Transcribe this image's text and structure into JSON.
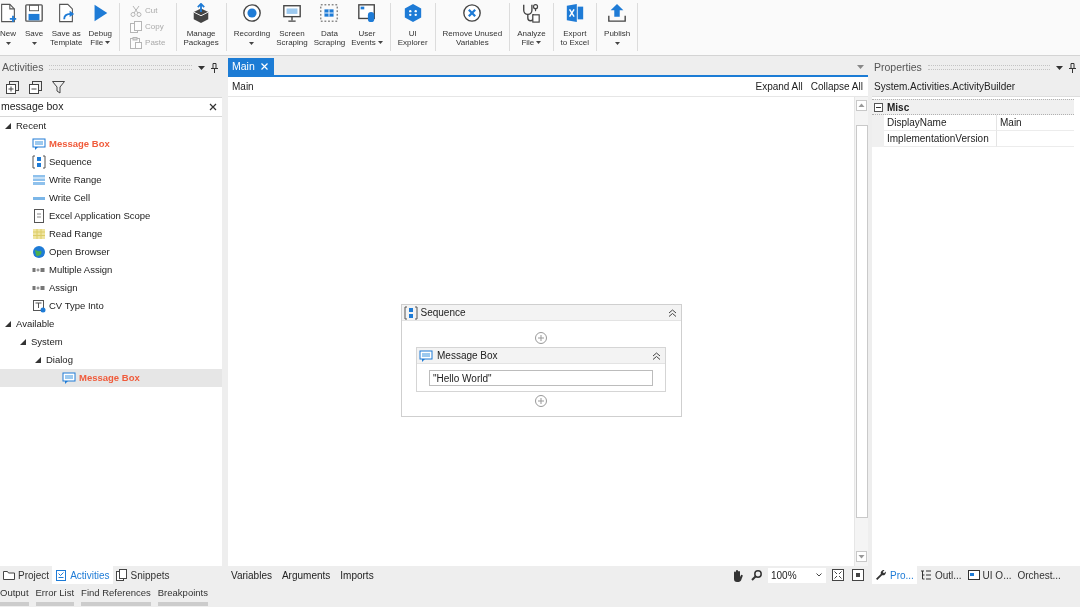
{
  "toolbar": {
    "groups": [
      {
        "kind": "large",
        "buttons": [
          {
            "label": "New",
            "dropdown": true,
            "disabled": false
          },
          {
            "label": "Save",
            "dropdown": true,
            "disabled": false
          },
          {
            "label": "Save as\nTemplate",
            "dropdown": false,
            "disabled": false
          },
          {
            "label": "Debug\nFile",
            "dropdown": true,
            "disabled": false
          }
        ]
      },
      {
        "kind": "small",
        "buttons": [
          {
            "label": "Cut",
            "disabled": true
          },
          {
            "label": "Copy",
            "disabled": true
          },
          {
            "label": "Paste",
            "disabled": true
          }
        ]
      },
      {
        "kind": "large",
        "buttons": [
          {
            "label": "Manage\nPackages",
            "dropdown": false,
            "disabled": false
          }
        ]
      },
      {
        "kind": "large",
        "buttons": [
          {
            "label": "Recording",
            "dropdown": true,
            "disabled": false
          },
          {
            "label": "Screen\nScraping",
            "dropdown": false,
            "disabled": false
          },
          {
            "label": "Data\nScraping",
            "dropdown": false,
            "disabled": false
          },
          {
            "label": "User\nEvents",
            "dropdown": true,
            "disabled": false
          }
        ]
      },
      {
        "kind": "large",
        "buttons": [
          {
            "label": "UI\nExplorer",
            "dropdown": false,
            "disabled": false
          }
        ]
      },
      {
        "kind": "large",
        "buttons": [
          {
            "label": "Remove Unused\nVariables",
            "dropdown": false,
            "disabled": false
          }
        ]
      },
      {
        "kind": "large",
        "buttons": [
          {
            "label": "Analyze\nFile",
            "dropdown": true,
            "disabled": false
          }
        ]
      },
      {
        "kind": "large",
        "buttons": [
          {
            "label": "Export\nto Excel",
            "dropdown": false,
            "disabled": false
          }
        ]
      },
      {
        "kind": "large",
        "buttons": [
          {
            "label": "Publish",
            "dropdown": true,
            "disabled": false
          }
        ]
      }
    ]
  },
  "activities_panel": {
    "title": "Activities",
    "search": {
      "value": "message box"
    },
    "tree": [
      {
        "label": "Recent",
        "kind": "category",
        "expanded": true,
        "selected": false,
        "matched": false,
        "children": [
          {
            "label": "Message Box",
            "kind": "activity",
            "selected": false,
            "matched": true
          },
          {
            "label": "Sequence",
            "kind": "activity",
            "selected": false,
            "matched": false
          },
          {
            "label": "Write Range",
            "kind": "activity",
            "selected": false,
            "matched": false
          },
          {
            "label": "Write Cell",
            "kind": "activity",
            "selected": false,
            "matched": false
          },
          {
            "label": "Excel Application Scope",
            "kind": "activity",
            "selected": false,
            "matched": false
          },
          {
            "label": "Read Range",
            "kind": "activity",
            "selected": false,
            "matched": false
          },
          {
            "label": "Open Browser",
            "kind": "activity",
            "selected": false,
            "matched": false
          },
          {
            "label": "Multiple Assign",
            "kind": "activity",
            "selected": false,
            "matched": false
          },
          {
            "label": "Assign",
            "kind": "activity",
            "selected": false,
            "matched": false
          },
          {
            "label": "CV Type Into",
            "kind": "activity",
            "selected": false,
            "matched": false
          }
        ]
      },
      {
        "label": "Available",
        "kind": "category",
        "expanded": true,
        "selected": false,
        "matched": false,
        "children": [
          {
            "label": "System",
            "kind": "category",
            "expanded": true,
            "selected": false,
            "matched": false,
            "children": [
              {
                "label": "Dialog",
                "kind": "category",
                "expanded": true,
                "selected": false,
                "matched": false,
                "children": [
                  {
                    "label": "Message Box",
                    "kind": "activity",
                    "selected": true,
                    "matched": true
                  }
                ]
              }
            ]
          }
        ]
      }
    ],
    "tabs": [
      {
        "label": "Project",
        "selected": false
      },
      {
        "label": "Activities",
        "selected": true
      },
      {
        "label": "Snippets",
        "selected": false
      }
    ]
  },
  "designer": {
    "tabs": [
      {
        "label": "Main",
        "selected": true
      }
    ],
    "breadcrumb": "Main",
    "actions": [
      "Expand All",
      "Collapse All"
    ],
    "sequence": {
      "title": "Sequence",
      "activities": [
        {
          "title": "Message Box",
          "text": "\"Hello World\""
        }
      ]
    },
    "footer_tabs": [
      "Variables",
      "Arguments",
      "Imports"
    ],
    "zoom": "100%"
  },
  "properties_panel": {
    "title": "Properties",
    "object_type": "System.Activities.ActivityBuilder",
    "categories": [
      {
        "name": "Misc",
        "expanded": true,
        "properties": [
          {
            "name": "DisplayName",
            "value": "Main"
          },
          {
            "name": "ImplementationVersion"
          }
        ]
      }
    ],
    "tabs": [
      {
        "label": "Pro...",
        "selected": true
      },
      {
        "label": "Outl...",
        "selected": false
      },
      {
        "label": "UI O...",
        "selected": false
      },
      {
        "label": "Orchest...",
        "selected": false
      }
    ]
  },
  "output_tabs": [
    "Output",
    "Error List",
    "Find References",
    "Breakpoints"
  ]
}
